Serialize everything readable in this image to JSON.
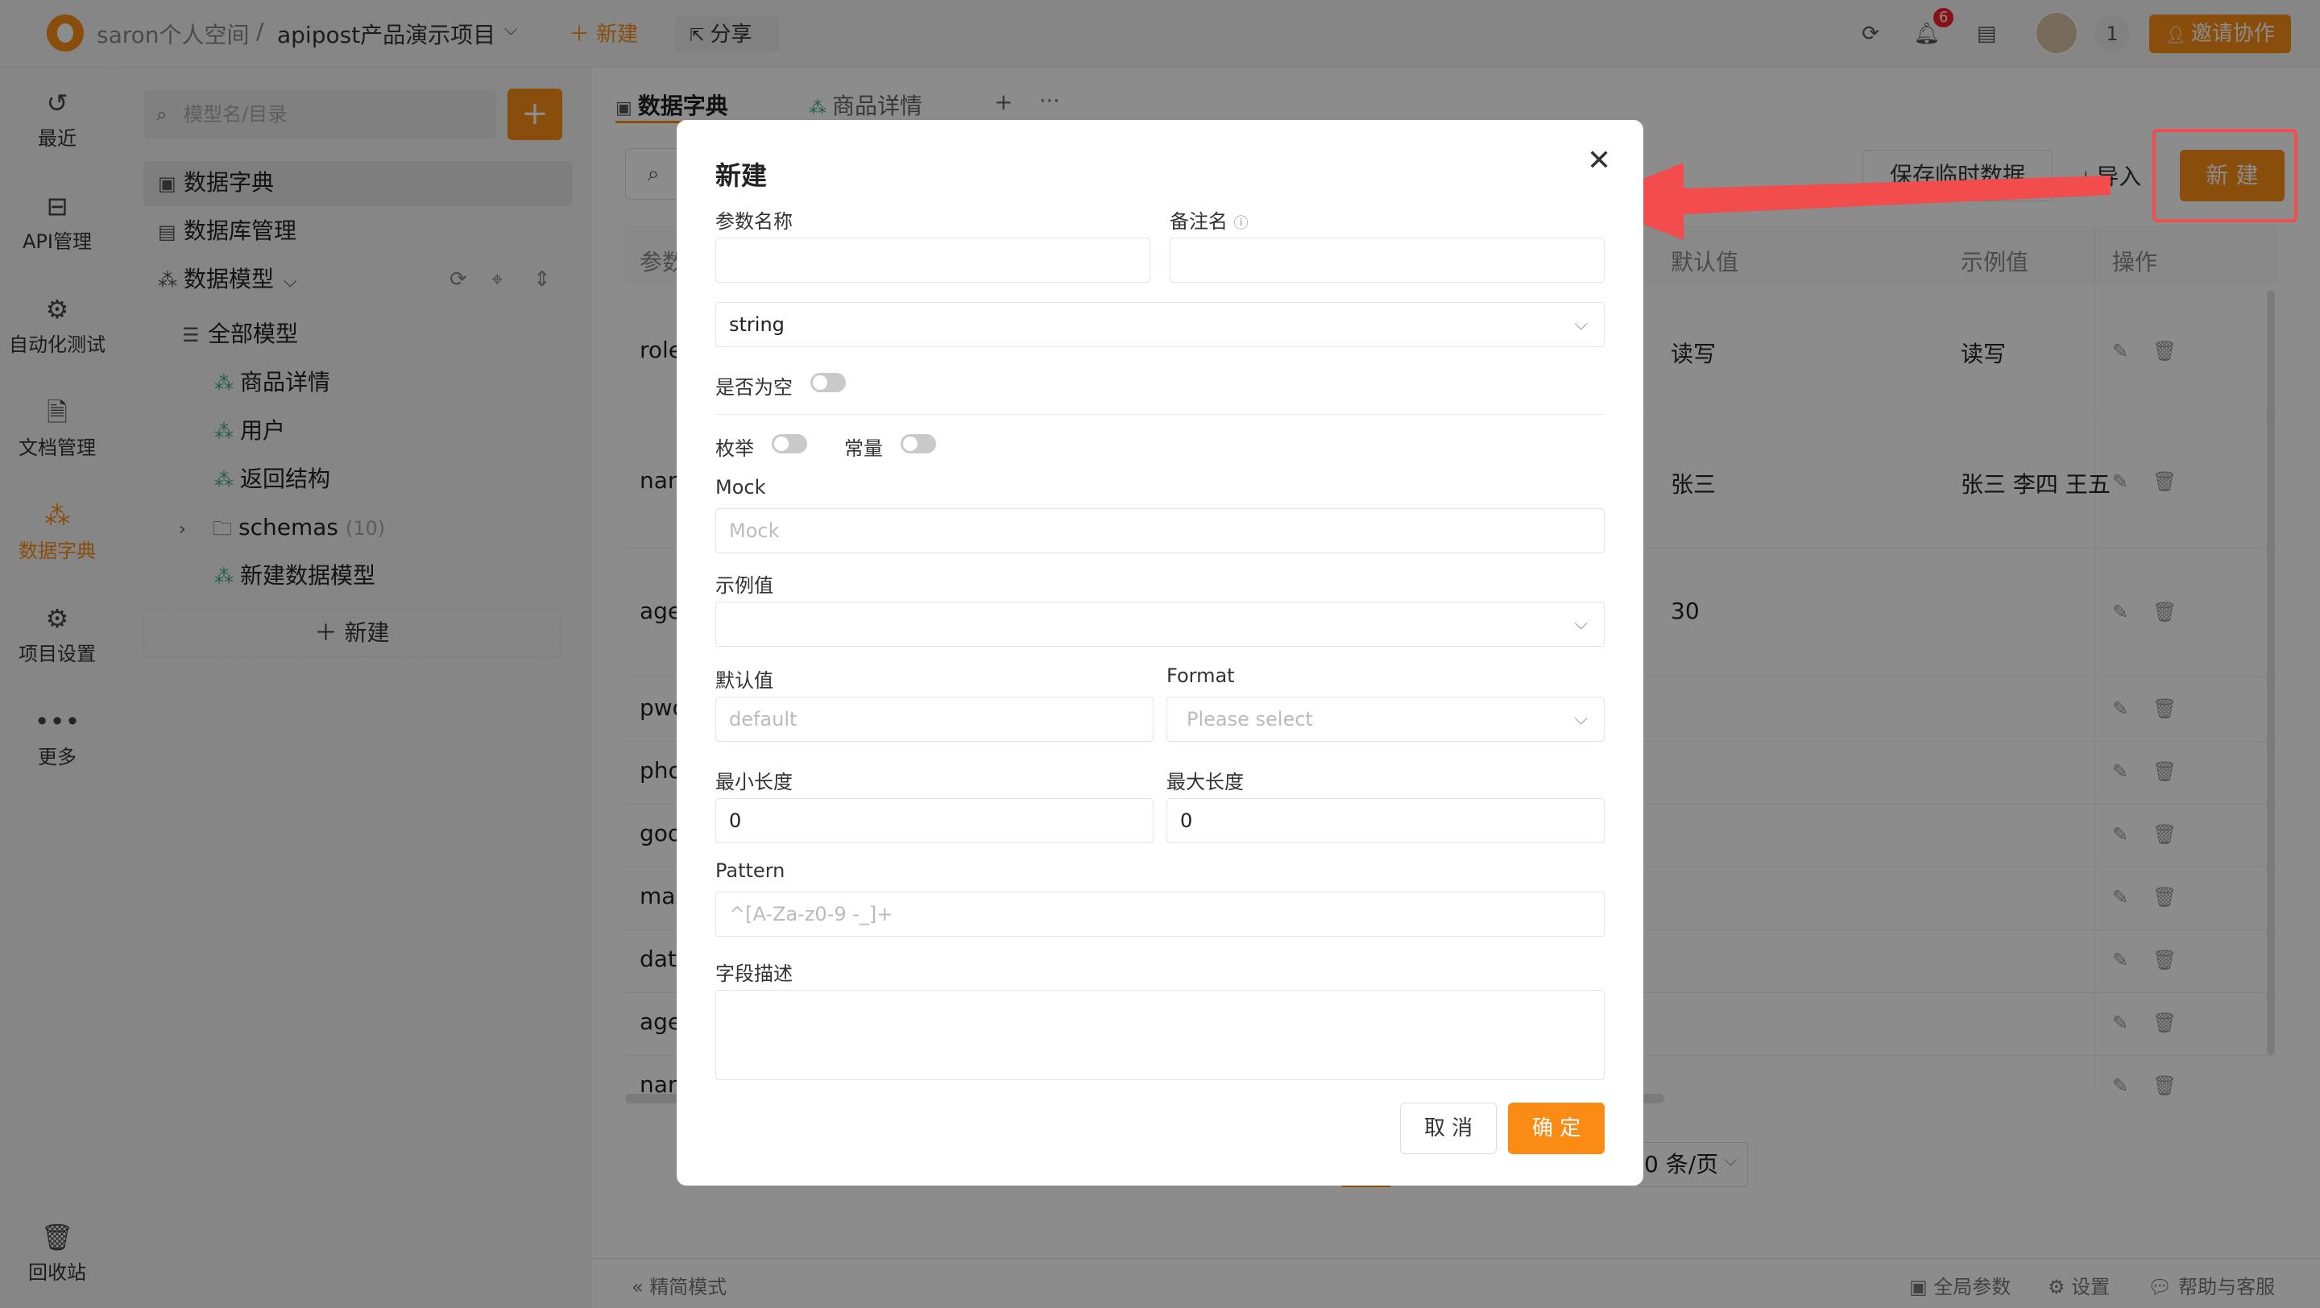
{
  "topbar": {
    "workspace": "saron个人空间",
    "separator": "/",
    "project": "apipost产品演示项目",
    "new_label": "＋ 新建",
    "share_label": "分享",
    "notif_count": "6",
    "user_count": "1",
    "invite_label": "邀请协作"
  },
  "rail": [
    {
      "icon": "history-icon",
      "label": "最近"
    },
    {
      "icon": "api-icon",
      "label": "API管理"
    },
    {
      "icon": "automation-icon",
      "label": "自动化测试"
    },
    {
      "icon": "document-icon",
      "label": "文档管理"
    },
    {
      "icon": "data-dictionary-icon",
      "label": "数据字典",
      "active": true
    },
    {
      "icon": "settings-icon",
      "label": "项目设置"
    },
    {
      "icon": "more-icon",
      "label": "更多"
    },
    {
      "icon": "trash-icon",
      "label": "回收站"
    }
  ],
  "tree": {
    "search_placeholder": "模型名/目录",
    "items": [
      {
        "label": "数据字典"
      },
      {
        "label": "数据库管理"
      },
      {
        "label": "数据模型"
      },
      {
        "label": "全部模型"
      },
      {
        "label": "商品详情"
      },
      {
        "label": "用户"
      },
      {
        "label": "返回结构"
      },
      {
        "label": "schemas",
        "count": "(10)"
      },
      {
        "label": "新建数据模型"
      }
    ],
    "new_label": "＋ 新建"
  },
  "tabs": [
    {
      "label": "数据字典"
    },
    {
      "label": "商品详情"
    }
  ],
  "toolbar": {
    "save_temp": "保存临时数据",
    "import": "导入",
    "new": "新 建"
  },
  "table": {
    "headers": [
      "参数",
      "默认值",
      "示例值",
      "操作"
    ],
    "rows": [
      {
        "name": "role",
        "default": "读写",
        "example": "读写"
      },
      {
        "name": "nam",
        "default": "张三",
        "example": "张三 李四 王五"
      },
      {
        "name": "age",
        "default": "30",
        "example": ""
      },
      {
        "name": "pwd",
        "default": "",
        "example": ""
      },
      {
        "name": "pho",
        "default": "",
        "example": ""
      },
      {
        "name": "goo",
        "default": "",
        "example": ""
      },
      {
        "name": "mas",
        "default": "",
        "example": ""
      },
      {
        "name": "data",
        "default": "",
        "example": ""
      },
      {
        "name": "age",
        "default": "",
        "example": ""
      },
      {
        "name": "nam",
        "default": "",
        "example": ""
      }
    ],
    "page_size": "0 条/页"
  },
  "footer": {
    "simple_mode": "精简模式",
    "global_params": "全局参数",
    "settings": "设置",
    "help": "帮助与客服"
  },
  "modal": {
    "title": "新建",
    "param_name_label": "参数名称",
    "remark_label": "备注名",
    "type_value": "string",
    "nullable_label": "是否为空",
    "enum_label": "枚举",
    "const_label": "常量",
    "mock_label": "Mock",
    "mock_placeholder": "Mock",
    "example_label": "示例值",
    "default_label": "默认值",
    "default_placeholder": "default",
    "format_label": "Format",
    "format_placeholder": "Please select",
    "min_len_label": "最小长度",
    "min_len_value": "0",
    "max_len_label": "最大长度",
    "max_len_value": "0",
    "pattern_label": "Pattern",
    "pattern_placeholder": "^[A-Za-z0-9 -_]+",
    "desc_label": "字段描述",
    "cancel_label": "取 消",
    "ok_label": "确 定"
  },
  "colors": {
    "accent": "#fa8c16",
    "annotation_red": "#f24c4c"
  }
}
